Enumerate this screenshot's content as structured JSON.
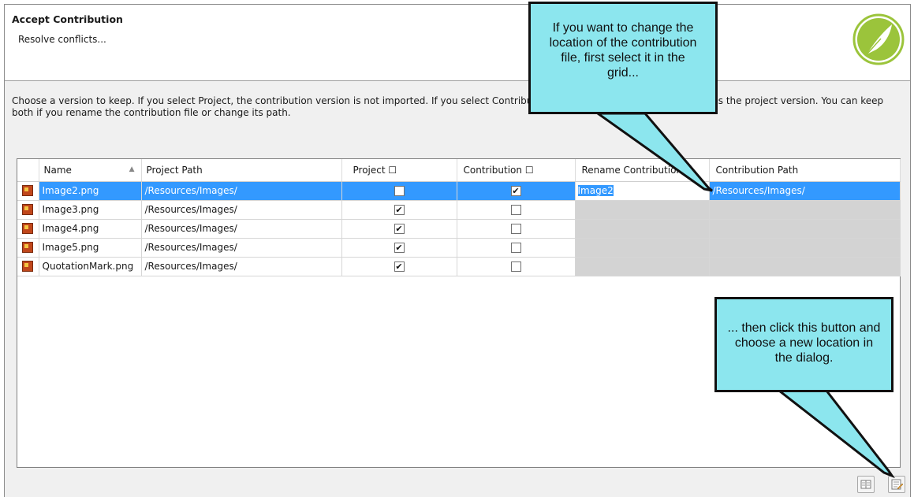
{
  "dialog": {
    "title": "Accept Contribution",
    "subtitle": "Resolve conflicts...",
    "instructions": "Choose a version to keep. If you select Project, the contribution version is not imported. If you select Contribution, the contribution version overwrites the project version. You can keep both if you rename the contribution file or change its path."
  },
  "grid": {
    "columns": [
      "Name",
      "Project Path",
      "Project ☐",
      "Contribution ☐",
      "Rename Contribution",
      "Contribution Path"
    ],
    "rows": [
      {
        "name": "Image2.png",
        "project_path": "/Resources/Images/",
        "project": false,
        "contribution": true,
        "rename": "Image2",
        "contribution_path": "/Resources/Images/",
        "selected": true
      },
      {
        "name": "Image3.png",
        "project_path": "/Resources/Images/",
        "project": true,
        "contribution": false,
        "rename": "",
        "contribution_path": "",
        "selected": false
      },
      {
        "name": "Image4.png",
        "project_path": "/Resources/Images/",
        "project": true,
        "contribution": false,
        "rename": "",
        "contribution_path": "",
        "selected": false
      },
      {
        "name": "Image5.png",
        "project_path": "/Resources/Images/",
        "project": true,
        "contribution": false,
        "rename": "",
        "contribution_path": "",
        "selected": false
      },
      {
        "name": "QuotationMark.png",
        "project_path": "/Resources/Images/",
        "project": true,
        "contribution": false,
        "rename": "",
        "contribution_path": "",
        "selected": false
      }
    ]
  },
  "callouts": {
    "top": "If you want to change the location of the contribution file, first select it in the grid...",
    "bottom": "... then click this button and choose a new location in the dialog."
  },
  "toolbar": {
    "icons": [
      "columns-icon",
      "browse-path-icon"
    ]
  },
  "colors": {
    "selection": "#3399ff",
    "callout": "#8ce6ee",
    "logo": "#9bc43b"
  }
}
